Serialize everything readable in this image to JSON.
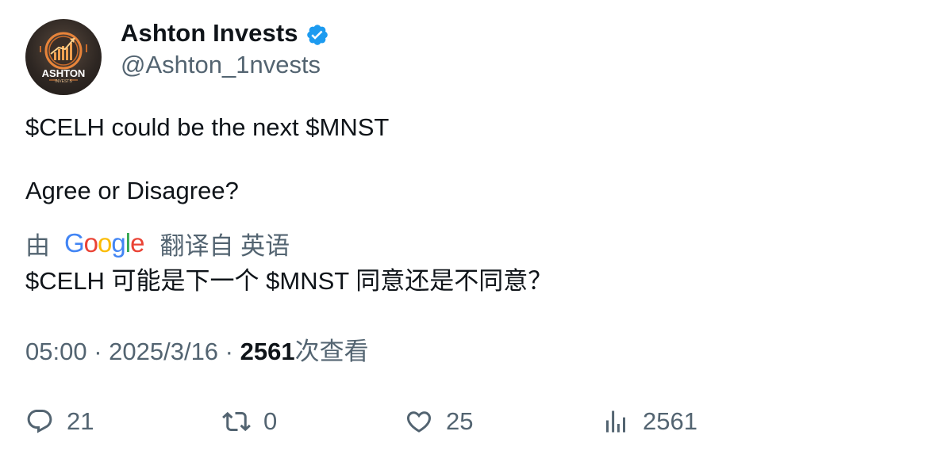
{
  "author": {
    "display_name": "Ashton Invests",
    "handle": "@Ashton_1nvests",
    "avatar_text": "ASHTON",
    "avatar_subtext": "INVESTS",
    "verified_icon": "verified-badge-icon"
  },
  "tweet": {
    "line1": "$CELH could be the next $MNST",
    "line2": "Agree or Disagree?"
  },
  "translation": {
    "prefix": "由",
    "provider": "Google",
    "suffix": "翻译自 英语",
    "text": "$CELH 可能是下一个 $MNST 同意还是不同意？"
  },
  "meta": {
    "time": "05:00",
    "separator": " · ",
    "date": "2025/3/16",
    "views_count": "2561",
    "views_label": "次查看"
  },
  "actions": {
    "reply_count": "21",
    "retweet_count": "0",
    "like_count": "25",
    "views_count": "2561"
  },
  "colors": {
    "text_primary": "#0f1419",
    "text_secondary": "#536471",
    "verified_blue": "#1d9bf0",
    "avatar_orange": "#e8843a"
  }
}
